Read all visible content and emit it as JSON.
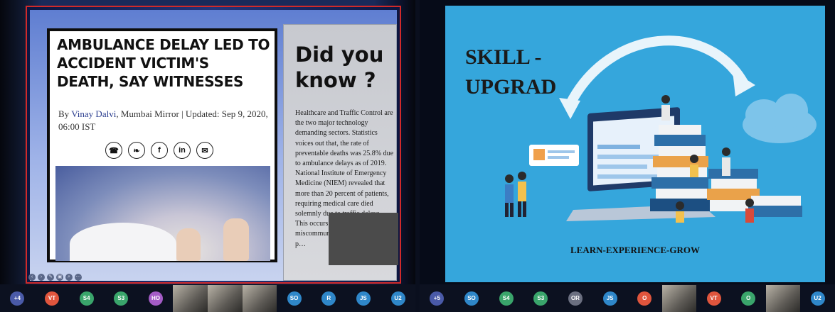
{
  "left_slide": {
    "article": {
      "headline": "AMBULANCE DELAY LED TO ACCIDENT VICTIM'S DEATH, SAY WITNESSES",
      "byline_prefix": "By ",
      "author": "Vinay Dalvi",
      "byline_suffix": ", Mumbai Mirror | Updated: Sep 9, 2020, 06:00 IST",
      "share_icons": [
        {
          "name": "whatsapp-icon",
          "glyph": "☎"
        },
        {
          "name": "twitter-icon",
          "glyph": "❧"
        },
        {
          "name": "facebook-icon",
          "glyph": "f"
        },
        {
          "name": "linkedin-icon",
          "glyph": "in"
        },
        {
          "name": "email-icon",
          "glyph": "✉"
        }
      ]
    },
    "aside": {
      "title": "Did you know ?",
      "body": "Healthcare and Traffic Control are the two major technology demanding sectors. Statistics voices out that, the rate of preventable deaths was 25.8% due to ambulance delays as of 2019. National Institute of Emergency Medicine (NIEM) revealed that more than 20 percent of patients, requiring medical care died solemnly due to traffic delays. This occurs ma… miscommunica… other form of p…"
    }
  },
  "right_slide": {
    "title_line1": "SKILL -",
    "title_line2": "UPGRAD",
    "tagline": "LEARN-EXPERIENCE-GROW"
  },
  "participants_left": [
    {
      "kind": "count",
      "label": "+4",
      "color": "#4a5aa8"
    },
    {
      "kind": "avatar",
      "label": "VT",
      "color": "#e0553d"
    },
    {
      "kind": "avatar",
      "label": "S4",
      "color": "#3aa56b"
    },
    {
      "kind": "avatar",
      "label": "S3",
      "color": "#3aa56b"
    },
    {
      "kind": "avatar",
      "label": "HO",
      "color": "#a45cc6"
    },
    {
      "kind": "video",
      "label": ""
    },
    {
      "kind": "video",
      "label": ""
    },
    {
      "kind": "video",
      "label": ""
    },
    {
      "kind": "avatar",
      "label": "SO",
      "color": "#2f87c9"
    },
    {
      "kind": "avatar",
      "label": "R",
      "color": "#2f87c9"
    },
    {
      "kind": "avatar",
      "label": "JS",
      "color": "#2f87c9"
    },
    {
      "kind": "avatar",
      "label": "U2",
      "color": "#2f87c9"
    }
  ],
  "participants_right": [
    {
      "kind": "count",
      "label": "+5",
      "color": "#4a5aa8"
    },
    {
      "kind": "avatar",
      "label": "SO",
      "color": "#2f87c9"
    },
    {
      "kind": "avatar",
      "label": "S4",
      "color": "#3aa56b"
    },
    {
      "kind": "avatar",
      "label": "S3",
      "color": "#3aa56b"
    },
    {
      "kind": "avatar",
      "label": "OR",
      "color": "#6b6f80"
    },
    {
      "kind": "avatar",
      "label": "JS",
      "color": "#2f87c9"
    },
    {
      "kind": "avatar",
      "label": "O",
      "color": "#e0553d"
    },
    {
      "kind": "video",
      "label": ""
    },
    {
      "kind": "avatar",
      "label": "VT",
      "color": "#e0553d"
    },
    {
      "kind": "avatar",
      "label": "O",
      "color": "#3aa56b"
    },
    {
      "kind": "video",
      "label": ""
    },
    {
      "kind": "avatar",
      "label": "U2",
      "color": "#2f87c9"
    }
  ]
}
